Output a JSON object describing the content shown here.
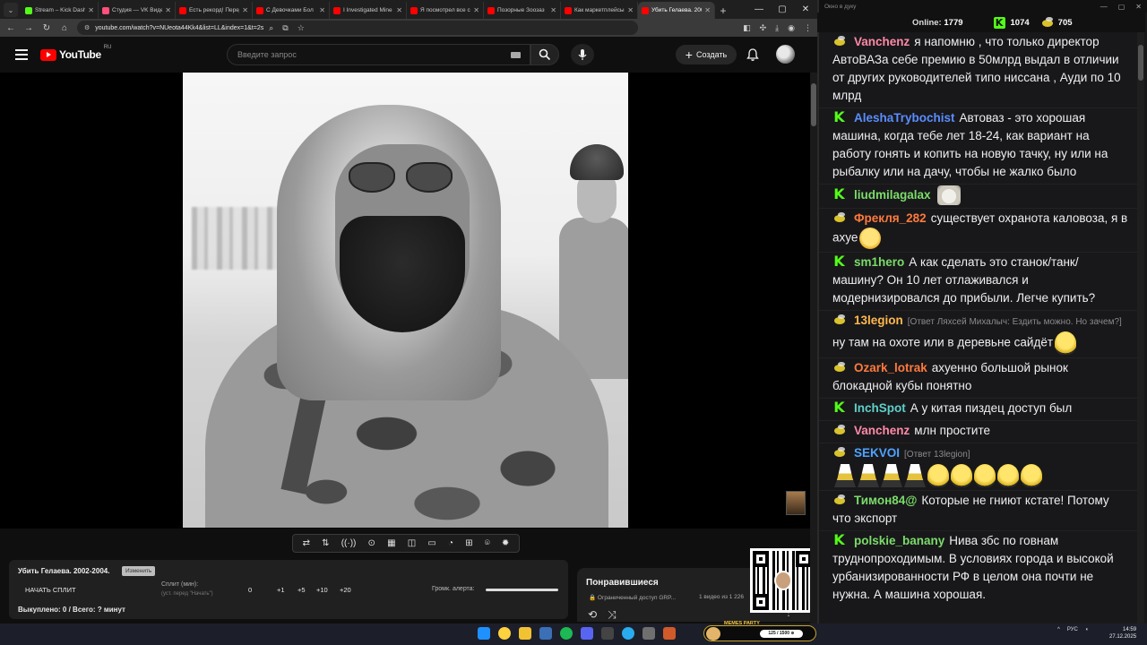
{
  "browser": {
    "tabs": [
      {
        "title": "Stream – Kick Dashboard",
        "color": "#53fc18",
        "active": false
      },
      {
        "title": "Студия — VK Видео",
        "color": "#ff4f7b",
        "active": false
      },
      {
        "title": "Есть рекорд! Перед",
        "color": "#ff0000",
        "active": false
      },
      {
        "title": "С Девочками Бол",
        "color": "#ff0000",
        "active": false
      },
      {
        "title": "I Investigated Mine",
        "color": "#ff0000",
        "active": false
      },
      {
        "title": "Я посмотрел все с",
        "color": "#ff0000",
        "active": false
      },
      {
        "title": "Позорные Зоозаз",
        "color": "#ff0000",
        "active": false
      },
      {
        "title": "Как маркетплейсы",
        "color": "#ff0000",
        "active": false
      },
      {
        "title": "Убить Гелаева. 200",
        "color": "#ff0000",
        "active": true
      }
    ],
    "url": "youtube.com/watch?v=NUeota44Kk4&list=LL&index=1&t=2s"
  },
  "youtube": {
    "logo": "YouTube",
    "region": "RU",
    "search_placeholder": "Введите запрос",
    "create_label": "Создать"
  },
  "panel": {
    "title": "Убить Гелаева. 2002-2004.",
    "edit_label": "Изменить",
    "start_split": "НАЧАТЬ СПЛИТ",
    "split_label": "Сплит (мин):",
    "split_hint": "(уст. перед \"Начать\")",
    "split_value": "0",
    "increments": [
      "+1",
      "+5",
      "+10",
      "+20"
    ],
    "volume_label": "Громк. алерта:",
    "volume_level": 1.0,
    "bought": "Выкуплено: 0 / Всего: ? минут"
  },
  "liked": {
    "title": "Понравившиеся",
    "subtitle": "🔒 Ограниченный доступ GRP...",
    "count": "1 видео из 1 226"
  },
  "chat": {
    "window_title": "Окно в дуку",
    "online_label": "Online:",
    "online_count": "1779",
    "kick_count": "1074",
    "other_count": "705",
    "messages": [
      {
        "badge": "bee",
        "user": "Vanchenz",
        "color": "#ff8aa8",
        "text": "я напомню , что только директор АвтоВАЗа себе премию в 50млрд выдал в отличии от других руководителей типо ниссана , Ауди по 10 млрд",
        "reply": "",
        "emotes": []
      },
      {
        "badge": "kick",
        "user": "AleshaTrybochist",
        "color": "#5a8dff",
        "text": "Автоваз - это хорошая машина, когда тебе лет 18-24, как вариант на работу гонять и копить на новую тачку, ну или на рыбалку или на дачу, чтобы не жалко было",
        "reply": "",
        "emotes": []
      },
      {
        "badge": "kick",
        "user": "liudmilagalax",
        "color": "#7bdc6a",
        "text": "",
        "reply": "",
        "emotes": [
          "cat"
        ]
      },
      {
        "badge": "bee",
        "user": "Фрекля_282",
        "color": "#ff7a3d",
        "text": "существует охранота каловоза, я в ахуе",
        "reply": "",
        "emotes": [
          "face"
        ]
      },
      {
        "badge": "kick",
        "user": "sm1hero",
        "color": "#7bdc6a",
        "text": "А как сделать это станок/танк/машину? Он 10 лет отлаживался и модернизировался до прибыли. Легче купить?",
        "reply": "",
        "emotes": []
      },
      {
        "badge": "bee",
        "user": "13legion",
        "color": "#ffb84d",
        "text": "ну там на охоте  или в деревьне   сайдёт",
        "reply": "[Ответ Ляхсей Михалыч: Ездить можно. Но зачем?]",
        "emotes": [
          "peepo"
        ]
      },
      {
        "badge": "bee",
        "user": "Ozark_lotrak",
        "color": "#ff7a3d",
        "text": "ахуенно большой рынок блокадной кубы понятно",
        "reply": "",
        "emotes": []
      },
      {
        "badge": "kick",
        "user": "InchSpot",
        "color": "#5fd0c9",
        "text": "А у китая пиздец доступ был",
        "reply": "",
        "emotes": []
      },
      {
        "badge": "bee",
        "user": "Vanchenz",
        "color": "#ff8aa8",
        "text": "млн простите",
        "reply": "",
        "emotes": []
      },
      {
        "badge": "bee",
        "user": "SEKVOI",
        "color": "#4fa3ff",
        "text": "",
        "reply": "[Ответ 13legion]",
        "emotes": [
          "dancer",
          "dancer",
          "dancer",
          "dancer",
          "peepo",
          "peepo",
          "peepo",
          "peepo",
          "peepo"
        ]
      },
      {
        "badge": "bee",
        "user": "Тимон84@",
        "color": "#7bdc6a",
        "text": "Которые не гниют кстате! Потому что экспорт",
        "reply": "",
        "emotes": []
      },
      {
        "badge": "kick",
        "user": "polskie_banany",
        "color": "#7bdc6a",
        "text": "Нива збс по говнам труднопроходимым. В условиях города и высокой урбанизированности РФ в целом она почти не нужна. А машина хорошая.",
        "reply": "",
        "emotes": []
      }
    ]
  },
  "overlay": {
    "memes_tag": "MEMES PARTY",
    "memes_progress": "125 / 1500 ⊕"
  },
  "taskbar": {
    "lang": "РУС",
    "time": "14:59",
    "date": "27.12.2025"
  }
}
